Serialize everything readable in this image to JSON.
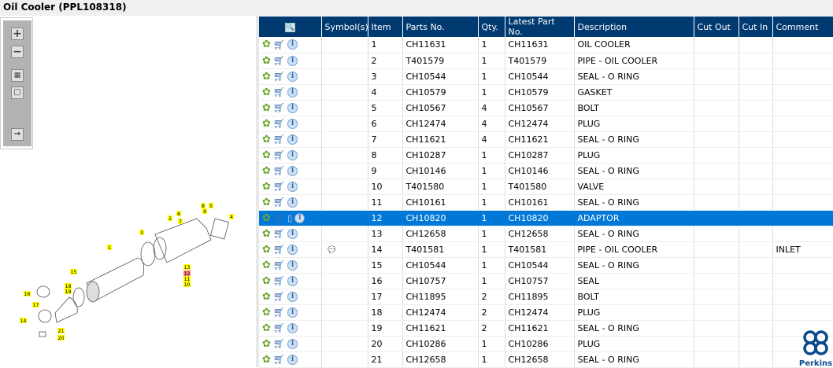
{
  "title": "Oil Cooler (PPL108318)",
  "toolbar": {
    "zoom_in": "zoom-in",
    "zoom_out": "zoom-out",
    "fit": "fit",
    "reset": "reset",
    "export": "export"
  },
  "diagram": {
    "callouts": [
      "1",
      "2",
      "3",
      "4",
      "5",
      "6",
      "7",
      "8",
      "9",
      "10",
      "11",
      "12",
      "13",
      "14",
      "15",
      "16",
      "17",
      "18",
      "19",
      "20",
      "21"
    ],
    "highlighted": "12"
  },
  "table": {
    "headers": [
      "",
      "Symbol(s)",
      "Item",
      "Parts No.",
      "Qty.",
      "Latest Part No.",
      "Description",
      "Cut Out",
      "Cut In",
      "Comment"
    ],
    "rows": [
      {
        "item": "1",
        "part": "CH11631",
        "qty": "1",
        "latest": "CH11631",
        "desc": "OIL COOLER",
        "symbol": "",
        "comment": ""
      },
      {
        "item": "2",
        "part": "T401579",
        "qty": "1",
        "latest": "T401579",
        "desc": "PIPE - OIL COOLER",
        "symbol": "",
        "comment": ""
      },
      {
        "item": "3",
        "part": "CH10544",
        "qty": "1",
        "latest": "CH10544",
        "desc": "SEAL - O RING",
        "symbol": "",
        "comment": ""
      },
      {
        "item": "4",
        "part": "CH10579",
        "qty": "1",
        "latest": "CH10579",
        "desc": "GASKET",
        "symbol": "",
        "comment": ""
      },
      {
        "item": "5",
        "part": "CH10567",
        "qty": "4",
        "latest": "CH10567",
        "desc": "BOLT",
        "symbol": "",
        "comment": ""
      },
      {
        "item": "6",
        "part": "CH12474",
        "qty": "4",
        "latest": "CH12474",
        "desc": "PLUG",
        "symbol": "",
        "comment": ""
      },
      {
        "item": "7",
        "part": "CH11621",
        "qty": "4",
        "latest": "CH11621",
        "desc": "SEAL - O RING",
        "symbol": "",
        "comment": ""
      },
      {
        "item": "8",
        "part": "CH10287",
        "qty": "1",
        "latest": "CH10287",
        "desc": "PLUG",
        "symbol": "",
        "comment": ""
      },
      {
        "item": "9",
        "part": "CH10146",
        "qty": "1",
        "latest": "CH10146",
        "desc": "SEAL - O RING",
        "symbol": "",
        "comment": ""
      },
      {
        "item": "10",
        "part": "T401580",
        "qty": "1",
        "latest": "T401580",
        "desc": "VALVE",
        "symbol": "",
        "comment": ""
      },
      {
        "item": "11",
        "part": "CH10161",
        "qty": "1",
        "latest": "CH10161",
        "desc": "SEAL - O RING",
        "symbol": "",
        "comment": ""
      },
      {
        "item": "12",
        "part": "CH10820",
        "qty": "1",
        "latest": "CH10820",
        "desc": "ADAPTOR",
        "symbol": "",
        "comment": "",
        "selected": true
      },
      {
        "item": "13",
        "part": "CH12658",
        "qty": "1",
        "latest": "CH12658",
        "desc": "SEAL - O RING",
        "symbol": "",
        "comment": ""
      },
      {
        "item": "14",
        "part": "T401581",
        "qty": "1",
        "latest": "T401581",
        "desc": "PIPE - OIL COOLER",
        "symbol": "comment-icon",
        "comment": "INLET"
      },
      {
        "item": "15",
        "part": "CH10544",
        "qty": "1",
        "latest": "CH10544",
        "desc": "SEAL - O RING",
        "symbol": "",
        "comment": ""
      },
      {
        "item": "16",
        "part": "CH10757",
        "qty": "1",
        "latest": "CH10757",
        "desc": "SEAL",
        "symbol": "",
        "comment": ""
      },
      {
        "item": "17",
        "part": "CH11895",
        "qty": "2",
        "latest": "CH11895",
        "desc": "BOLT",
        "symbol": "",
        "comment": ""
      },
      {
        "item": "18",
        "part": "CH12474",
        "qty": "2",
        "latest": "CH12474",
        "desc": "PLUG",
        "symbol": "",
        "comment": ""
      },
      {
        "item": "19",
        "part": "CH11621",
        "qty": "2",
        "latest": "CH11621",
        "desc": "SEAL - O RING",
        "symbol": "",
        "comment": ""
      },
      {
        "item": "20",
        "part": "CH10286",
        "qty": "1",
        "latest": "CH10286",
        "desc": "PLUG",
        "symbol": "",
        "comment": ""
      },
      {
        "item": "21",
        "part": "CH12658",
        "qty": "1",
        "latest": "CH12658",
        "desc": "SEAL - O RING",
        "symbol": "",
        "comment": ""
      }
    ]
  },
  "logo": {
    "text": "Perkins"
  },
  "colors": {
    "header": "#003a70",
    "selected": "#0078d7",
    "callout": "#ffff00",
    "callout_selected": "#ff8080"
  }
}
